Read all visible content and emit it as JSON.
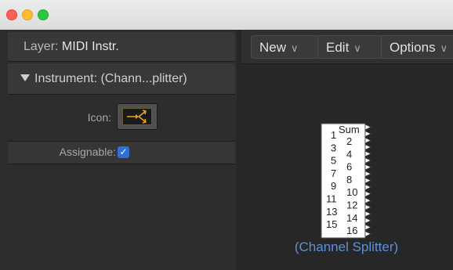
{
  "window": {
    "traffic_lights": {
      "close": "#fe5f57",
      "minimize": "#febc2e",
      "zoom": "#28c840"
    }
  },
  "inspector": {
    "layer_label": "Layer:",
    "layer_value": "MIDI Instr.",
    "instrument_header": "Instrument:  (Chann...plitter)",
    "icon_label": "Icon:",
    "assignable_label": "Assignable:",
    "assignable_checked": true
  },
  "toolbar": {
    "new_label": "New",
    "edit_label": "Edit",
    "options_label": "Options"
  },
  "object": {
    "name": "(Channel Splitter)",
    "sum_label": "Sum",
    "left_channels": [
      "1",
      "3",
      "5",
      "7",
      "9",
      "11",
      "13",
      "15"
    ],
    "right_channels": [
      "2",
      "4",
      "6",
      "8",
      "10",
      "12",
      "14",
      "16"
    ]
  },
  "colors": {
    "accent_blue": "#2f6fd6",
    "caption_blue": "#5f8fd8",
    "icon_orange": "#f0a21f"
  }
}
